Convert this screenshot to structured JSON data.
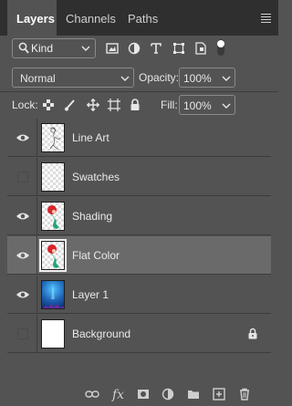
{
  "tabs": [
    {
      "label": "Layers",
      "active": true
    },
    {
      "label": "Channels",
      "active": false
    },
    {
      "label": "Paths",
      "active": false
    }
  ],
  "filter": {
    "kind_label": "Kind",
    "icons": [
      "image-filter-icon",
      "adjustment-filter-icon",
      "type-filter-icon",
      "shape-filter-icon",
      "smart-object-filter-icon",
      "filter-toggle-icon"
    ]
  },
  "blend": {
    "mode": "Normal",
    "opacity_label": "Opacity:",
    "opacity_value": "100%"
  },
  "lock": {
    "label": "Lock:",
    "icons": [
      "lock-transparent-pixels-icon",
      "lock-image-pixels-icon",
      "lock-position-icon",
      "lock-artboard-icon",
      "lock-all-icon"
    ],
    "fill_label": "Fill:",
    "fill_value": "100%"
  },
  "layers": [
    {
      "name": "Line Art",
      "visible": true,
      "selected": false,
      "locked": false,
      "thumb": "line-art"
    },
    {
      "name": "Swatches",
      "visible": false,
      "selected": false,
      "locked": false,
      "thumb": "transparent"
    },
    {
      "name": "Shading",
      "visible": true,
      "selected": false,
      "locked": false,
      "thumb": "mermaid"
    },
    {
      "name": "Flat Color",
      "visible": true,
      "selected": true,
      "locked": false,
      "thumb": "mermaid"
    },
    {
      "name": "Layer 1",
      "visible": true,
      "selected": false,
      "locked": false,
      "thumb": "underwater"
    },
    {
      "name": "Background",
      "visible": false,
      "selected": false,
      "locked": true,
      "thumb": "white"
    }
  ],
  "footer_icons": [
    "link-layers-icon",
    "fx-icon",
    "add-mask-icon",
    "new-adjustment-layer-icon",
    "new-group-icon",
    "new-layer-icon",
    "delete-layer-icon"
  ],
  "colors": {
    "panel": "#535353",
    "tabbar": "#2f2f2f",
    "selected_row": "#6a6a6a",
    "text": "#e6e6e6"
  }
}
